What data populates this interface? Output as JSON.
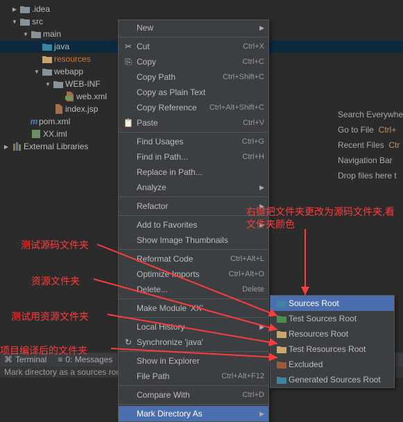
{
  "tree": {
    "idea": ".idea",
    "src": "src",
    "main": "main",
    "java": "java",
    "resources": "resources",
    "webapp": "webapp",
    "webinf": "WEB-INF",
    "webxml": "web.xml",
    "indexjsp": "index.jsp",
    "pom": "pom.xml",
    "pom_prefix": "m",
    "xximl": "XX.iml",
    "extlib": "External Libraries"
  },
  "hints": {
    "search": "Search Everywhe",
    "goto": "Go to File",
    "goto_k": "Ctrl+",
    "recent": "Recent Files",
    "recent_k": "Ctr",
    "nav": "Navigation Bar",
    "drop": "Drop files here t"
  },
  "menu": {
    "new": "New",
    "cut": "Cut",
    "cut_k": "Ctrl+X",
    "copy": "Copy",
    "copy_k": "Ctrl+C",
    "copyPath": "Copy Path",
    "copyPath_k": "Ctrl+Shift+C",
    "copyPlain": "Copy as Plain Text",
    "copyRef": "Copy Reference",
    "copyRef_k": "Ctrl+Alt+Shift+C",
    "paste": "Paste",
    "paste_k": "Ctrl+V",
    "findUsages": "Find Usages",
    "findUsages_k": "Ctrl+G",
    "findInPath": "Find in Path...",
    "findInPath_k": "Ctrl+H",
    "replaceInPath": "Replace in Path...",
    "analyze": "Analyze",
    "refactor": "Refactor",
    "addFav": "Add to Favorites",
    "showThumb": "Show Image Thumbnails",
    "reformat": "Reformat Code",
    "reformat_k": "Ctrl+Alt+L",
    "optimize": "Optimize Imports",
    "optimize_k": "Ctrl+Alt+O",
    "delete": "Delete...",
    "delete_k": "Delete",
    "makeMod": "Make Module 'XX'",
    "localHist": "Local History",
    "sync": "Synchronize 'java'",
    "showExp": "Show in Explorer",
    "filePath": "File Path",
    "filePath_k": "Ctrl+Alt+F12",
    "compare": "Compare With",
    "compare_k": "Ctrl+D",
    "markDir": "Mark Directory As"
  },
  "submenu": {
    "sources": "Sources Root",
    "testSources": "Test Sources Root",
    "resources": "Resources Root",
    "testResources": "Test Resources Root",
    "excluded": "Excluded",
    "generated": "Generated Sources Root"
  },
  "anno": {
    "main": "右键把文件夹更改为源码文件夹,看文件夹颜色",
    "a1": "测试源码文件夹",
    "a2": "资源文件夹",
    "a3": "测试用资源文件夹",
    "a4": "项目编译后的文件夹"
  },
  "bottom": {
    "terminal": "Terminal",
    "messages": "0: Messages"
  },
  "status": "Mark directory as a sources roo"
}
